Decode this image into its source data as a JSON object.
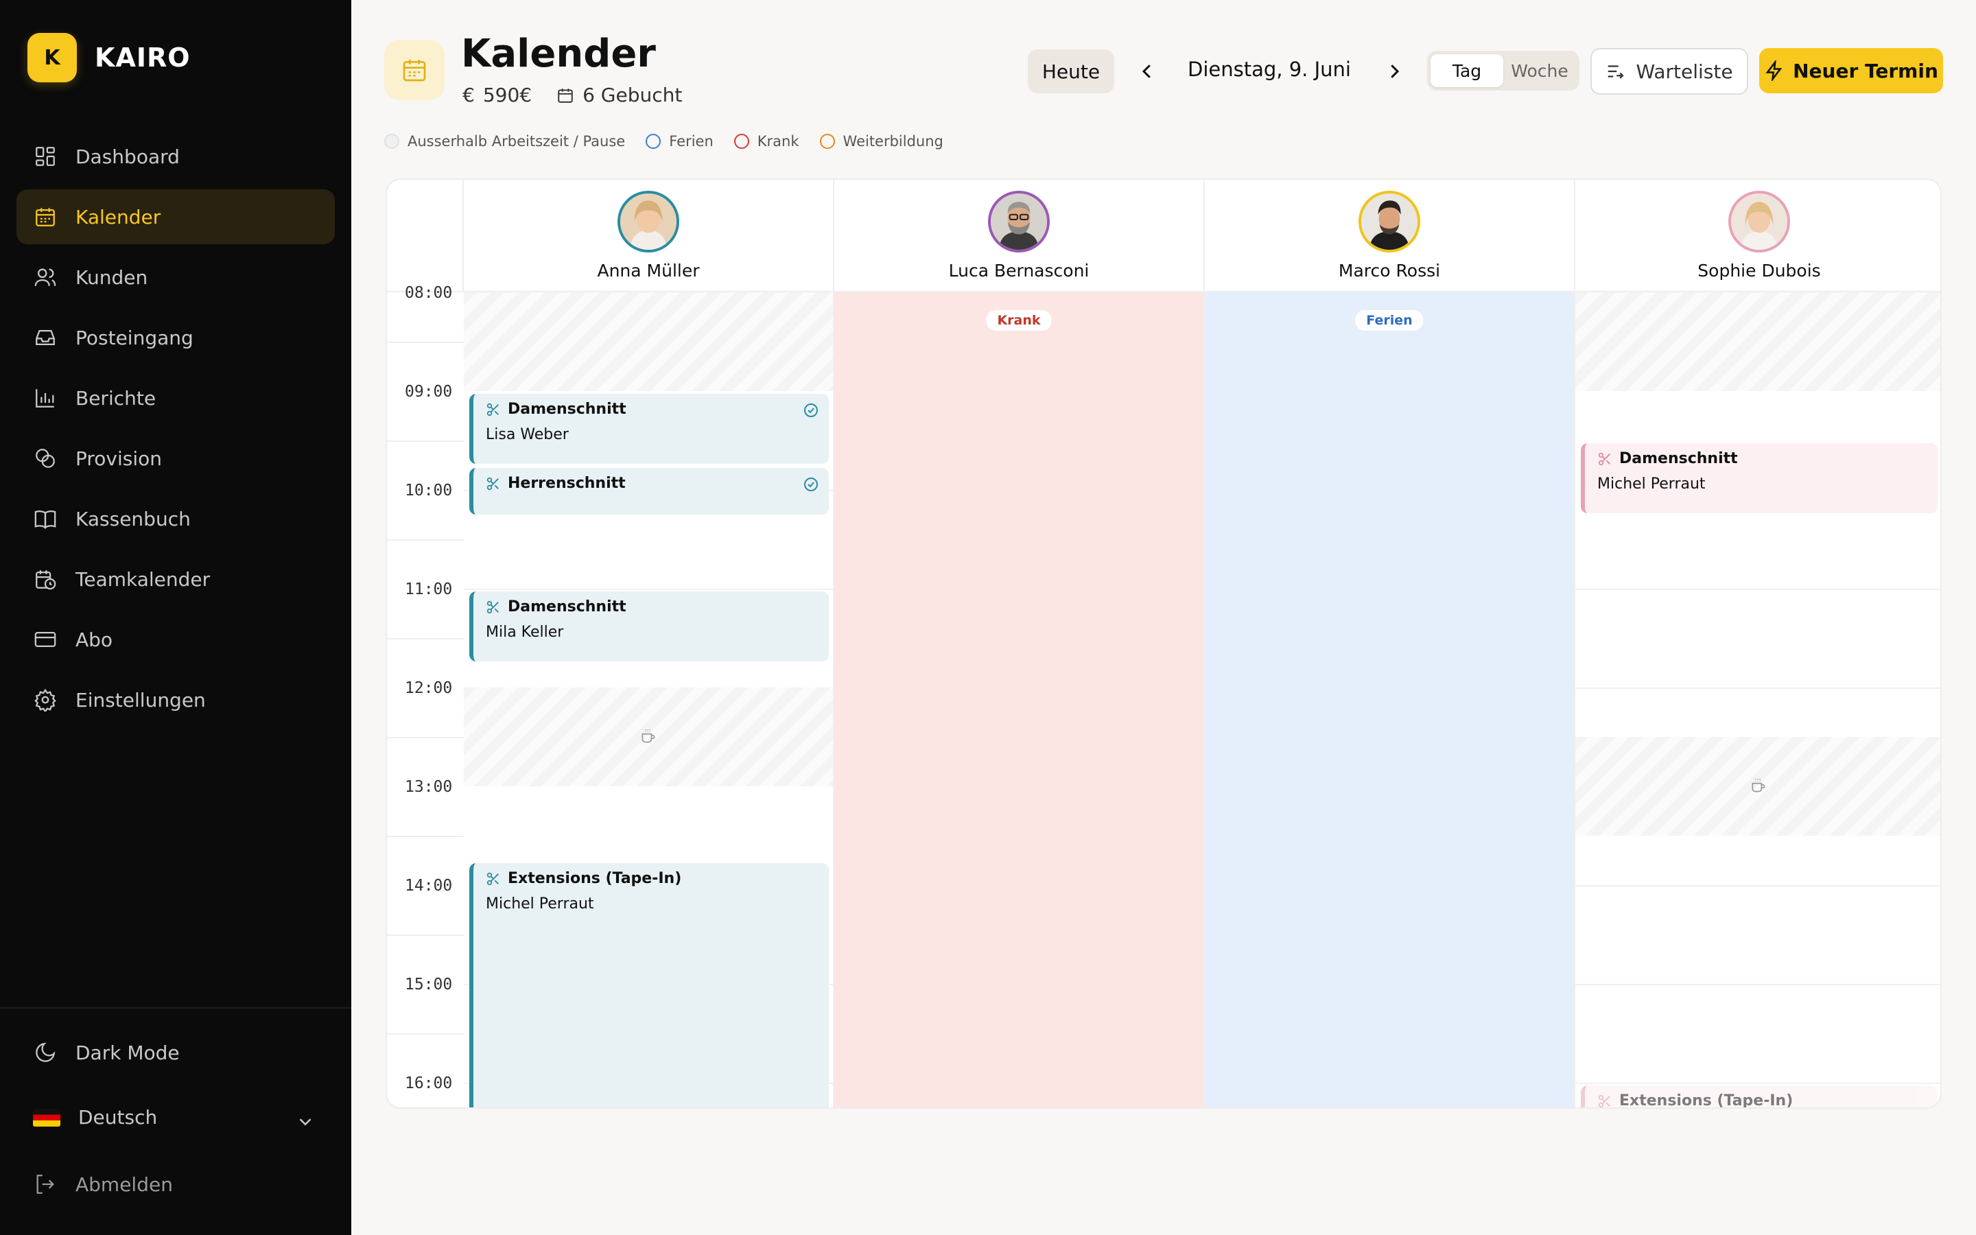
{
  "brand": {
    "logo_letter": "K",
    "name": "KAIRO",
    "accent": "#f7c81e"
  },
  "nav": [
    {
      "label": "Dashboard",
      "icon": "dashboard-icon"
    },
    {
      "label": "Kalender",
      "icon": "calendar-icon",
      "active": true
    },
    {
      "label": "Kunden",
      "icon": "users-icon"
    },
    {
      "label": "Posteingang",
      "icon": "inbox-icon"
    },
    {
      "label": "Berichte",
      "icon": "chart-icon"
    },
    {
      "label": "Provision",
      "icon": "coins-icon"
    },
    {
      "label": "Kassenbuch",
      "icon": "book-icon"
    },
    {
      "label": "Teamkalender",
      "icon": "team-calendar-icon"
    },
    {
      "label": "Abo",
      "icon": "card-icon"
    },
    {
      "label": "Einstellungen",
      "icon": "gear-icon"
    }
  ],
  "bottom": {
    "dark_mode": "Dark Mode",
    "language": "Deutsch",
    "logout": "Abmelden"
  },
  "header": {
    "title": "Kalender",
    "revenue": "590€",
    "booked": "6 Gebucht",
    "today": "Heute",
    "date": "Dienstag, 9. Juni",
    "view_day": "Tag",
    "view_week": "Woche",
    "waitlist": "Warteliste",
    "new_appointment": "Neuer Termin"
  },
  "legend": {
    "outside": "Ausserhalb Arbeitszeit / Pause",
    "vacation": "Ferien",
    "sick": "Krank",
    "training": "Weiterbildung"
  },
  "times": [
    "08:00",
    "09:00",
    "10:00",
    "11:00",
    "12:00",
    "13:00",
    "14:00",
    "15:00",
    "16:00"
  ],
  "staff": [
    {
      "name": "Anna Müller",
      "ring": "#2a8da0"
    },
    {
      "name": "Luca Bernasconi",
      "ring": "#9b59b6"
    },
    {
      "name": "Marco Rossi",
      "ring": "#f0c419"
    },
    {
      "name": "Sophie Dubois",
      "ring": "#e7a3b4"
    }
  ],
  "badges": {
    "sick": "Krank",
    "vacation": "Ferien"
  },
  "events": {
    "anna1": {
      "title": "Damenschnitt",
      "client": "Lisa Weber"
    },
    "anna2": {
      "title": "Herrenschnitt"
    },
    "anna3": {
      "title": "Damenschnitt",
      "client": "Mila Keller"
    },
    "anna4": {
      "title": "Extensions (Tape-In)",
      "client": "Michel Perraut"
    },
    "sophie1": {
      "title": "Damenschnitt",
      "client": "Michel Perraut"
    },
    "sophie2": {
      "title": "Extensions (Tape-In)"
    }
  }
}
